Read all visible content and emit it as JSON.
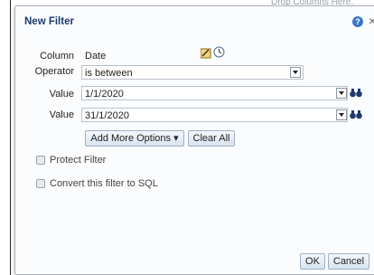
{
  "background": {
    "hint_text": "Drop Columns Here."
  },
  "dialog": {
    "title": "New Filter",
    "help_symbol": "?",
    "close_symbol": "×"
  },
  "form": {
    "column_label": "Column",
    "column_value": "Date",
    "operator_label": "Operator",
    "operator_value": "is between",
    "value1_label": "Value",
    "value1": "1/1/2020",
    "value2_label": "Value",
    "value2": "31/1/2020"
  },
  "buttons": {
    "add_more_options": "Add More Options ▾",
    "clear_all": "Clear All",
    "ok": "OK",
    "cancel": "Cancel"
  },
  "options": {
    "protect_filter": "Protect Filter",
    "convert_sql": "Convert this filter to SQL"
  },
  "colors": {
    "title": "#1d3a6e",
    "accent": "#3b77c7"
  },
  "icons": [
    "edit-icon",
    "clock-icon",
    "binoculars-icon",
    "help-icon",
    "close-icon"
  ]
}
